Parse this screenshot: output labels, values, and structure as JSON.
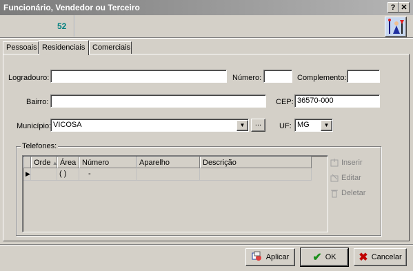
{
  "window": {
    "title": "Funcionário, Vendedor ou Terceiro",
    "help_label": "?",
    "close_label": "✕"
  },
  "header": {
    "code": "52",
    "logo_icon": "wand-figure-icon"
  },
  "tabs": [
    {
      "label": "Pessoais",
      "active": false
    },
    {
      "label": "Residenciais",
      "active": true
    },
    {
      "label": "Comerciais",
      "active": false
    }
  ],
  "form": {
    "logradouro": {
      "label": "Logradouro:",
      "value": ""
    },
    "numero": {
      "label": "Número:",
      "value": ""
    },
    "complemento": {
      "label": "Complemento:",
      "value": ""
    },
    "bairro": {
      "label": "Bairro:",
      "value": ""
    },
    "cep": {
      "label": "CEP:",
      "value": "36570-000"
    },
    "municipio": {
      "label": "Município:",
      "value": "VICOSA",
      "browse_label": "..."
    },
    "uf": {
      "label": "UF:",
      "value": "MG"
    }
  },
  "telefones": {
    "label": "Telefones:",
    "columns": [
      "Orde",
      "Área",
      "Número",
      "Aparelho",
      "Descrição"
    ],
    "rows": [
      {
        "orde": "",
        "area": "( )",
        "numero": "-",
        "aparelho": "",
        "descricao": ""
      }
    ],
    "actions": {
      "insert": "Inserir",
      "edit": "Editar",
      "delete": "Deletar"
    }
  },
  "footer": {
    "apply": "Aplicar",
    "ok": "OK",
    "cancel": "Cancelar"
  },
  "colors": {
    "ok_check": "#1a8f1a",
    "cancel_x": "#c00000",
    "code_text": "#008080"
  }
}
